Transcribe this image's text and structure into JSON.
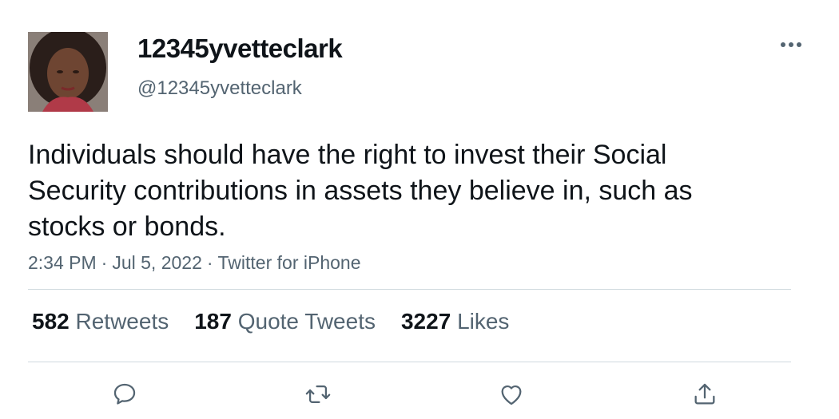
{
  "tweet": {
    "display_name": "12345yvetteclark",
    "handle": "@12345yvetteclark",
    "text": "Individuals should have the right to invest their Social Security contributions in assets they believe in, such as stocks or bonds.",
    "time": "2:34 PM",
    "date": "Jul 5, 2022",
    "source": "Twitter for iPhone",
    "separator": "·"
  },
  "stats": {
    "retweets_count": "582",
    "retweets_label": "Retweets",
    "quote_tweets_count": "187",
    "quote_tweets_label": "Quote Tweets",
    "likes_count": "3227",
    "likes_label": "Likes"
  },
  "icons": {
    "more": "more-horizontal-icon",
    "reply": "reply-icon",
    "retweet": "retweet-icon",
    "like": "heart-icon",
    "share": "share-icon"
  },
  "colors": {
    "text_primary": "#0f1419",
    "text_secondary": "#536471",
    "divider": "#cfd9de",
    "icon": "#536471"
  }
}
